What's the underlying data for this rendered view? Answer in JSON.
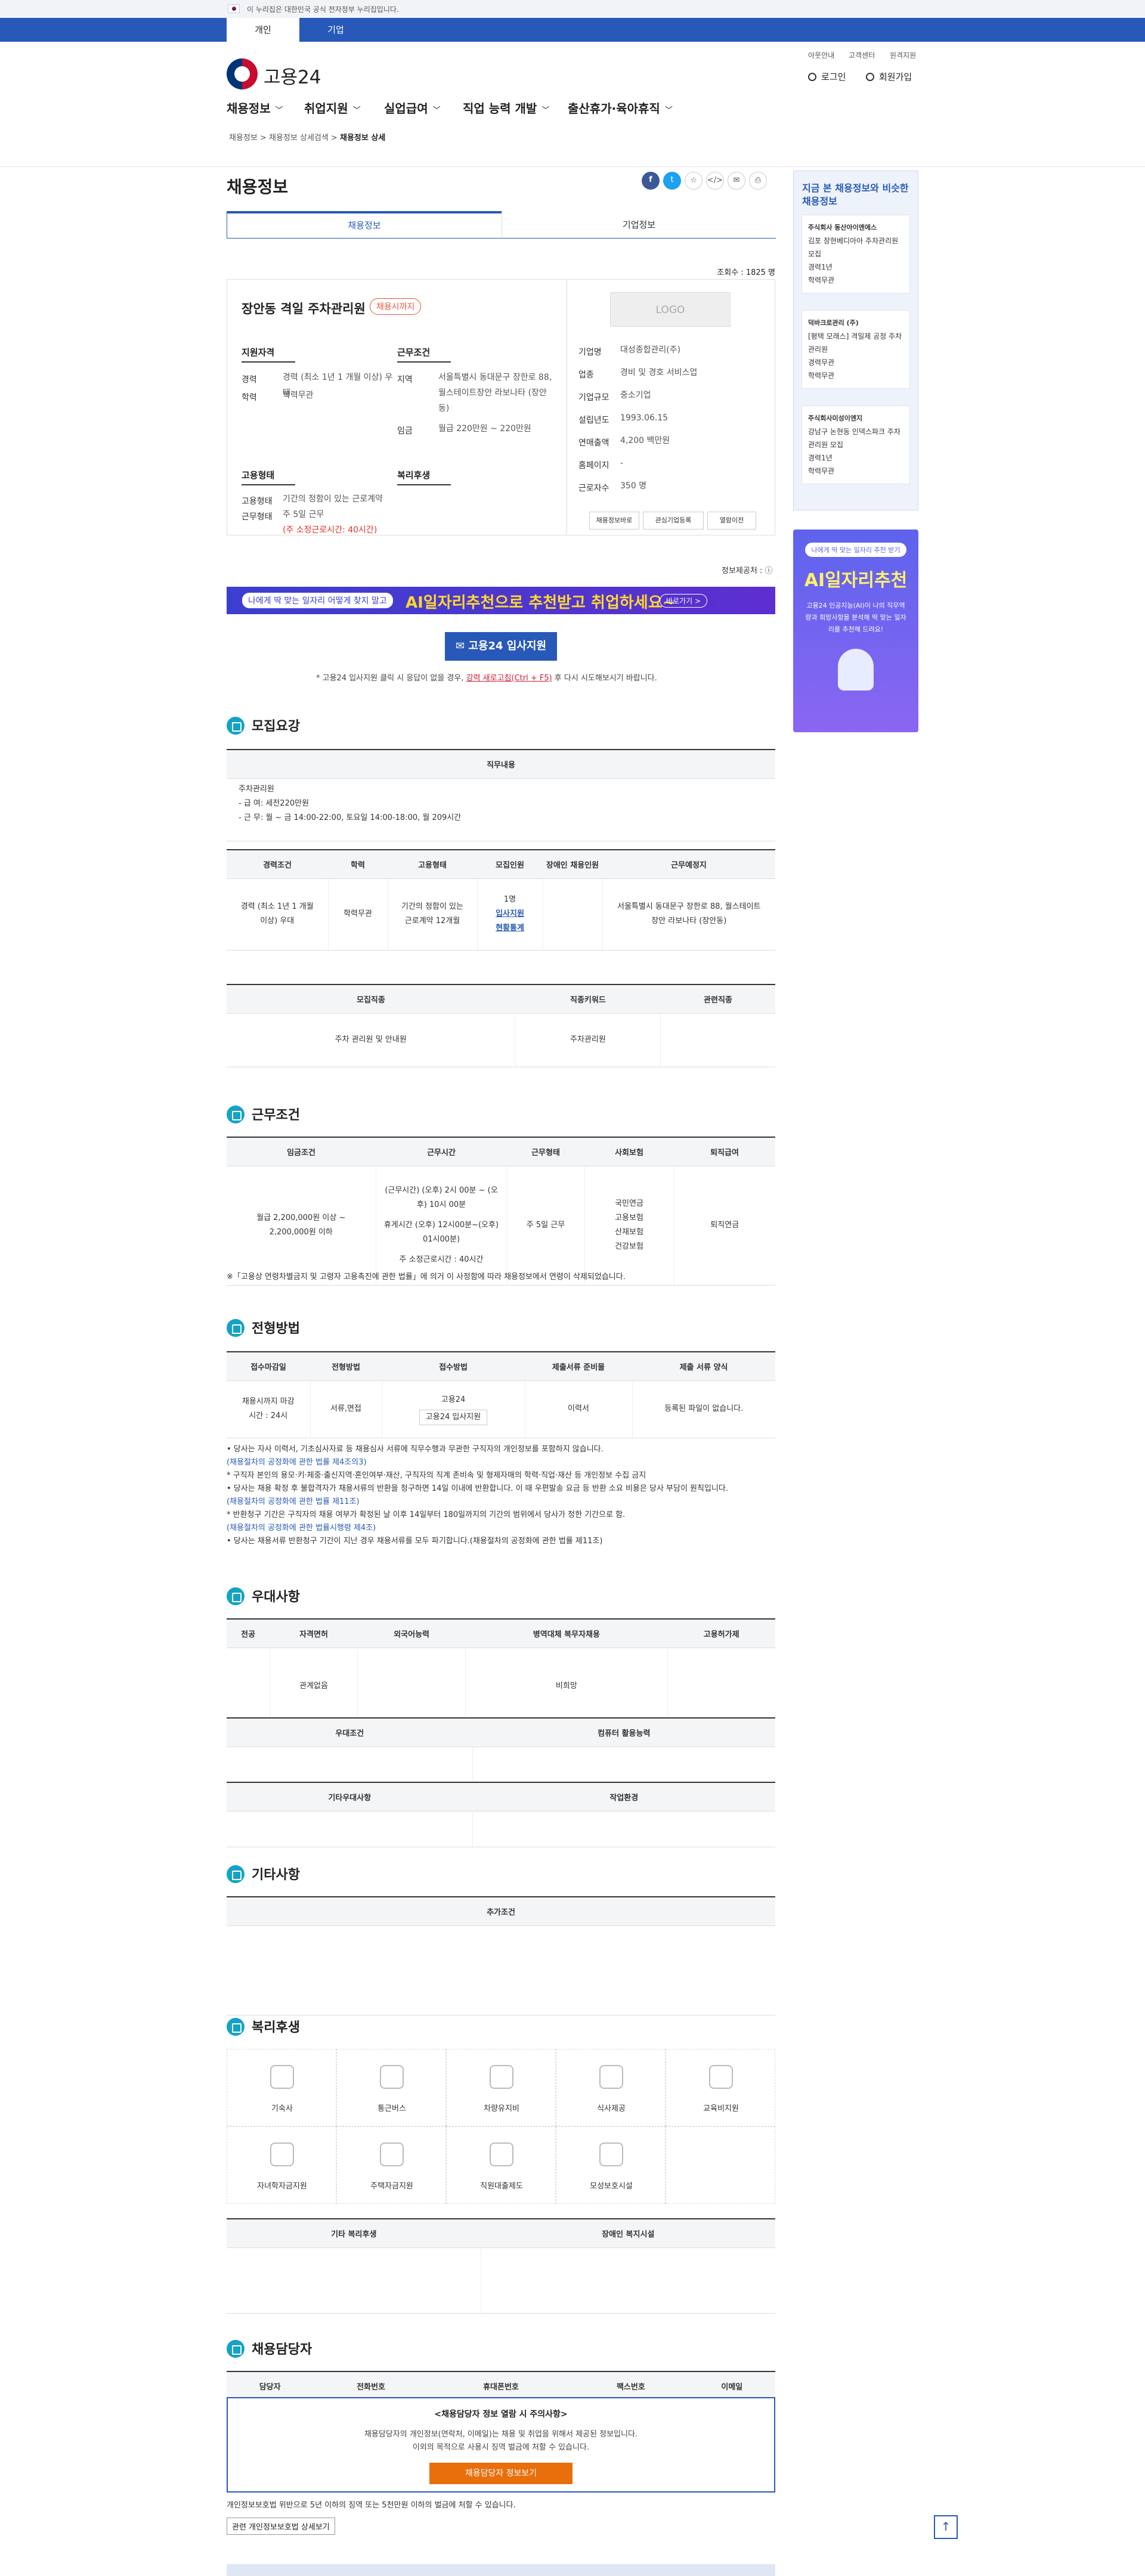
{
  "govbar": "이 누리집은 대한민국 공식 전자정부 누리집입니다.",
  "usertabs": [
    "개인",
    "기업"
  ],
  "toplinks": [
    "아웃안내",
    "고객센터",
    "원격지원"
  ],
  "logo": "고용24",
  "login": "로그인",
  "signup": "회원가입",
  "gnb": [
    "채용정보",
    "취업지원",
    "실업급여",
    "직업 능력 개발",
    "출산휴가·육아휴직"
  ],
  "breadcrumb": {
    "a": "채용정보",
    "b": "채용정보 상세검색",
    "c": "채용정보 상세"
  },
  "page_title": "채용정보",
  "tabs": [
    "채용정보",
    "기업정보"
  ],
  "views": "조회수 : 1825 명",
  "job": {
    "title": "장안동 격일 주차관리원",
    "badge": "채용시까지",
    "qual_h": "지원자격",
    "career_l": "경력",
    "career_v": "경력 (최소 1년 1 개월 이상) 우대",
    "edu_l": "학력",
    "edu_v": "학력무관",
    "cond_h": "근무조건",
    "loc_l": "지역",
    "loc_v": "서울특별시 동대문구 장한로 88, 월스테이트장안 라보나타 (장안동)",
    "pay_l": "임금",
    "pay_v": "월급 220만원 ~ 220만원",
    "emp_h": "고용형태",
    "emptype_l": "고용형태",
    "emptype_v": "기간의 정함이 있는 근로계약",
    "work_l": "근무형태",
    "work_v": "주 5일 근무",
    "hours": "(주 소정근로시간: 40시간)",
    "welf_h": "복리후생"
  },
  "company": {
    "logo": "LOGO",
    "rows": [
      [
        "기업명",
        "대성종합관리(주)"
      ],
      [
        "업종",
        "경비 및 경호 서비스업"
      ],
      [
        "기업규모",
        "중소기업"
      ],
      [
        "설립년도",
        "1993.06.15"
      ],
      [
        "연매출액",
        "4,200 백만원"
      ],
      [
        "홈페이지",
        "-"
      ],
      [
        "근로자수",
        "350 명"
      ]
    ],
    "btns": [
      "채용정보바로",
      "관심기업등록",
      "열람이전"
    ]
  },
  "info_fix": "정보제공처 : ⓘ",
  "banner": {
    "p1": "나에게 딱 맞는 일자리 어떻게 찾지 말고",
    "p2": "AI일자리추천으로 추천받고 취업하세요~",
    "p3": "바로가기 >"
  },
  "apply": {
    "btn": "✉ 고용24 입사지원",
    "note1": "* 고용24 입사지원 클릭 시 응답이 없을 경우, ",
    "note_link": "강력 새로고침(Ctrl + F5)",
    "note2": " 후 다시 시도해보시기 바랍니다."
  },
  "sec1": {
    "title": "모집요강",
    "duty_h": "직무내용",
    "duty": [
      "주차관리원",
      "- 급 여: 세전220만원",
      "- 근 무: 월 ~ 금 14:00-22:00, 토요일 14:00-18:00, 월 209시간"
    ],
    "t1h": [
      "경력조건",
      "학력",
      "고용형태",
      "모집인원",
      "장애인 채용인원",
      "근무예정지"
    ],
    "t1r": [
      "경력 (최소 1년 1 개월 이상) 우대",
      "학력무관",
      "기간의 정함이 있는 근로계약 12개월",
      "1명",
      "",
      "서울특별시 동대문구 장한로 88, 월스테이트장안 라보나타 (장안동)"
    ],
    "apply_link": "입사지원",
    "stat_link": "현황통계",
    "t2h": [
      "모집직종",
      "직종키워드",
      "관련직종"
    ],
    "t2r": [
      "주차 관리원 및 안내원",
      "주차관리원",
      ""
    ]
  },
  "sec2": {
    "title": "근무조건",
    "th": [
      "임금조건",
      "근무시간",
      "근무형태",
      "사회보험",
      "퇴직급여"
    ],
    "pay": "월급 2,200,000원 이상 ~ 2,200,000원 이하",
    "time1": "(근무시간) (오후) 2시 00분 ~ (오후) 10시 00분",
    "time2": "휴게시간 (오후) 12시00분~(오후) 01시00분)",
    "time3": "주 소정근로시간 : 40시간",
    "worktype": "주 5일 근무",
    "ins": [
      "국민연금",
      "고용보험",
      "산재보험",
      "건강보험"
    ],
    "ret": "퇴직연금",
    "note": "※「고용상 연령차별금지 및 고령자 고용촉진에 관한 법률」에 의거 이 사정함에 따라 채용정보에서 연령이 삭제되었습니다."
  },
  "sec3": {
    "title": "전형방법",
    "th": [
      "접수마감일",
      "전형방법",
      "접수방법",
      "제출서류 준비물",
      "제출 서류 양식"
    ],
    "r": [
      "채용시까지 마감시간 : 24시",
      "서류,면접",
      "고용24",
      "이력서",
      "등록된 파일이 없습니다."
    ],
    "r_btn": "고용24 입사지원",
    "notes": [
      "• 당사는 자사 이력서, 기초심사자료 등 채용심사 서류에 직무수행과 무관한 구직자의 개인정보를 포함하지 않습니다.",
      "(채용절차의 공정화에 관한 법률 제4조의3)",
      "* 구직자 본인의 용모·키·체중·출신지역·혼인여부·재산, 구직자의 직계 존비속 및 형제자매의 학력·직업·재산 등 개인정보 수집 금지",
      "• 당사는 채용 확정 후 불합격자가 채용서류의 반환을 청구하면 14일 이내에 반환합니다. 이 때 우편발송 요금 등 반환 소요 비용은 당사 부담이 원칙입니다.",
      "(채용절차의 공정화에 관한 법률 제11조)",
      "* 반환청구 기간은 구직자의 채용 여부가 확정된 날 이후 14일부터 180일까지의 기간의 범위에서 당사가 정한 기간으로 함.",
      "(채용절차의 공정화에 관한 법률시행령 제4조)",
      "• 당사는 채용서류 반환청구 기간이 지난 경우 채용서류를 모두 파기합니다.(채용절차의 공정화에 관한 법률 제11조)"
    ]
  },
  "sec4": {
    "title": "우대사항",
    "th": [
      "전공",
      "자격면허",
      "외국어능력",
      "병역대체 복무자채용",
      "고용허가제"
    ],
    "r": [
      "",
      "관계없음",
      "",
      "비희망",
      ""
    ],
    "th2": [
      "우대조건",
      "컴퓨터 활용능력"
    ],
    "th3": [
      "기타우대사항",
      "작업환경"
    ]
  },
  "sec5": {
    "title": "기타사항",
    "th": "추가조건"
  },
  "sec6": {
    "title": "복리후생",
    "items": [
      "기숙사",
      "통근버스",
      "차량유지비",
      "식사제공",
      "교육비지원",
      "자녀학자금지원",
      "주택자금지원",
      "직원대출제도",
      "모성보호시설"
    ],
    "th": [
      "기타 복리후생",
      "장애인 복지시설"
    ]
  },
  "sec7": {
    "title": "채용담당자",
    "th": [
      "담당자",
      "전화번호",
      "휴대폰번호",
      "팩스번호",
      "이메일"
    ],
    "box_t": "<채용담당자 정보 열람 시 주의사항>",
    "box1": "채용담당자의 개인정보(연락처, 이메일)는 채용 및 취업을 위해서 제공된 정보입니다.",
    "box2": "이외의 목적으로 사용시 징역 벌금에 처할 수 있습니다.",
    "box_btn": "채용담당자 정보보기",
    "law": "개인정보보호법 위반으로 5년 이하의 징역 또는 5천만원 이하의 벌금에 처할 수 있습니다.",
    "law_btn": "관련 개인정보보호법 상세보기"
  },
  "side": {
    "title": "지금 본 채용정보와 비슷한 채용정보",
    "cards": [
      [
        "주식회사 동산아이엔에스",
        "김포 장현베디아아 주차관리원 모집",
        "경력1년",
        "학력무관"
      ],
      [
        "덕바크로관리 (주)",
        "[평택 모래스] 격일제 공정 주차관리원",
        "경력무관",
        "학력무관"
      ],
      [
        "주식회사미성이엔지",
        "강남구 논현동 인덱스파크 주차관리원 모집",
        "경력1년",
        "학력무관"
      ]
    ],
    "ai_pill": "나에게 딱 맞는 일자리 추천 받기",
    "ai_title": "AI일자리추천",
    "ai_desc": "고용24 인공지능(AI)이 나의 직무역량과 희망사항을 분석해 딱 맞는 일자리를 추천해 드려요!"
  },
  "top": "↑"
}
